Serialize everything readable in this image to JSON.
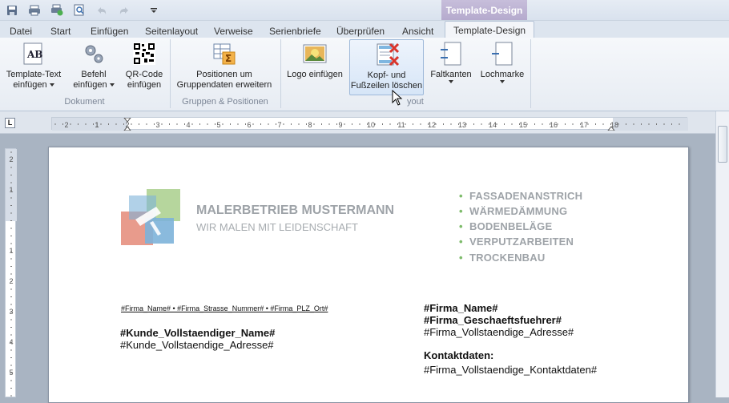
{
  "qat": {
    "icons": [
      "save-icon",
      "print-icon",
      "print-preview-icon",
      "zoom-icon",
      "undo-icon",
      "redo-icon",
      "customize-icon"
    ]
  },
  "context_tab_header": "Template-Design",
  "tabs": [
    "Datei",
    "Start",
    "Einfügen",
    "Seitenlayout",
    "Verweise",
    "Serienbriefe",
    "Überprüfen",
    "Ansicht",
    "Template-Design"
  ],
  "active_tab": "Template-Design",
  "ribbon": {
    "groups": [
      {
        "label": "Dokument",
        "buttons": [
          {
            "line1": "Template-Text",
            "line2": "einfügen",
            "dropdown": true,
            "icon": "ab-text-icon"
          },
          {
            "line1": "Befehl",
            "line2": "einfügen",
            "dropdown": true,
            "icon": "gears-icon"
          },
          {
            "line1": "QR-Code",
            "line2": "einfügen",
            "dropdown": false,
            "icon": "qr-code-icon"
          }
        ]
      },
      {
        "label": "Gruppen & Positionen",
        "buttons": [
          {
            "line1": "Positionen um",
            "line2": "Gruppendaten erweitern",
            "dropdown": false,
            "icon": "table-sum-icon"
          }
        ]
      },
      {
        "label": "Layout",
        "label_visible": "yout",
        "buttons": [
          {
            "line1": "Logo einfügen",
            "line2": "",
            "dropdown": false,
            "icon": "image-icon"
          },
          {
            "line1": "Kopf- und",
            "line2": "Fußzeilen löschen",
            "dropdown": false,
            "icon": "delete-header-footer-icon"
          },
          {
            "line1": "Faltkanten",
            "line2": "",
            "dropdown": true,
            "icon": "fold-marks-icon"
          },
          {
            "line1": "Lochmarke",
            "line2": "",
            "dropdown": true,
            "icon": "punch-mark-icon"
          }
        ]
      }
    ]
  },
  "ruler": {
    "left_marker": "L",
    "h_numbers": [
      "2",
      "1",
      "1",
      "2",
      "3",
      "4",
      "5",
      "6",
      "7",
      "8",
      "9",
      "10",
      "11",
      "12",
      "13",
      "14",
      "15",
      "16",
      "17",
      "18"
    ],
    "v_numbers": [
      "2",
      "1",
      "1",
      "2",
      "3",
      "4",
      "5"
    ]
  },
  "document": {
    "company_name": "MALERBETRIEB MUSTERMANN",
    "slogan": "WIR MALEN MIT LEIDENSCHAFT",
    "services": [
      "FASSADENANSTRICH",
      "WÄRMEDÄMMUNG",
      "BODENBELÄGE",
      "VERPUTZARBEITEN",
      "TROCKENBAU"
    ],
    "sender_line": "#Firma_Name# • #Firma_Strasse_Nummer# • #Firma_PLZ_Ort#",
    "recipient_name": "#Kunde_Vollstaendiger_Name#",
    "recipient_address": "#Kunde_Vollstaendige_Adresse#",
    "firma_name": "#Firma_Name#",
    "firma_gf": "#Firma_Geschaeftsfuehrer#",
    "firma_address": "#Firma_Vollstaendige_Adresse#",
    "contact_label": "Kontaktdaten:",
    "contact_data": "#Firma_Vollstaendige_Kontaktdaten#"
  },
  "colors": {
    "context_tab": "#b5aacd",
    "service_bullet": "#7dbb6a",
    "service_text": "#9ea3a8",
    "ribbon_hover": "#d6e5f7"
  }
}
